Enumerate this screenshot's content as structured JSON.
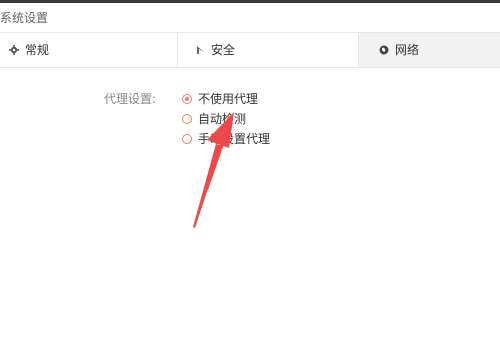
{
  "window": {
    "title": "系统设置"
  },
  "tabs": [
    {
      "label": "常规",
      "icon": "gear-icon",
      "selected": false
    },
    {
      "label": "安全",
      "icon": "shield-icon",
      "selected": false
    },
    {
      "label": "网络",
      "icon": "globe-icon",
      "selected": true
    }
  ],
  "network": {
    "proxy_label": "代理设置:",
    "options": [
      {
        "label": "不使用代理",
        "checked": true
      },
      {
        "label": "自动检测",
        "checked": false
      },
      {
        "label": "手动设置代理",
        "checked": false
      }
    ]
  },
  "annotation": {
    "icon": "red-arrow-icon",
    "color": "#f04848"
  },
  "colors": {
    "accent": "#f07f5f",
    "selected_tab_bg": "#f2f2f2"
  }
}
